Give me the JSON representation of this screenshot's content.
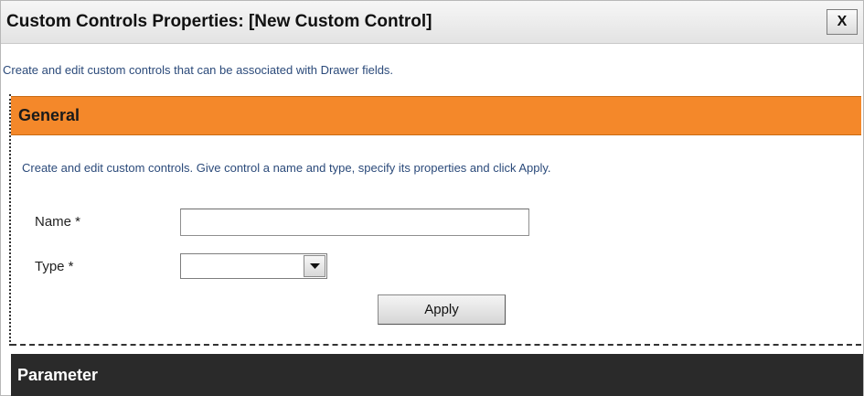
{
  "window": {
    "title": "Custom Controls Properties: [New Custom Control]",
    "close_label": "X",
    "description": "Create and edit custom controls that can be associated with Drawer fields."
  },
  "general": {
    "header": "General",
    "description": "Create and edit custom controls. Give control a name and type, specify its properties and click Apply.",
    "name_label": "Name *",
    "name_value": "",
    "type_label": "Type *",
    "type_value": "",
    "apply_label": "Apply"
  },
  "parameter": {
    "header": "Parameter"
  },
  "colors": {
    "general_header_bg": "#f4882a",
    "parameter_header_bg": "#2a2a2a",
    "description_text": "#2b4a7a"
  },
  "icons": {
    "type_dropdown": "chevron-down-icon"
  }
}
